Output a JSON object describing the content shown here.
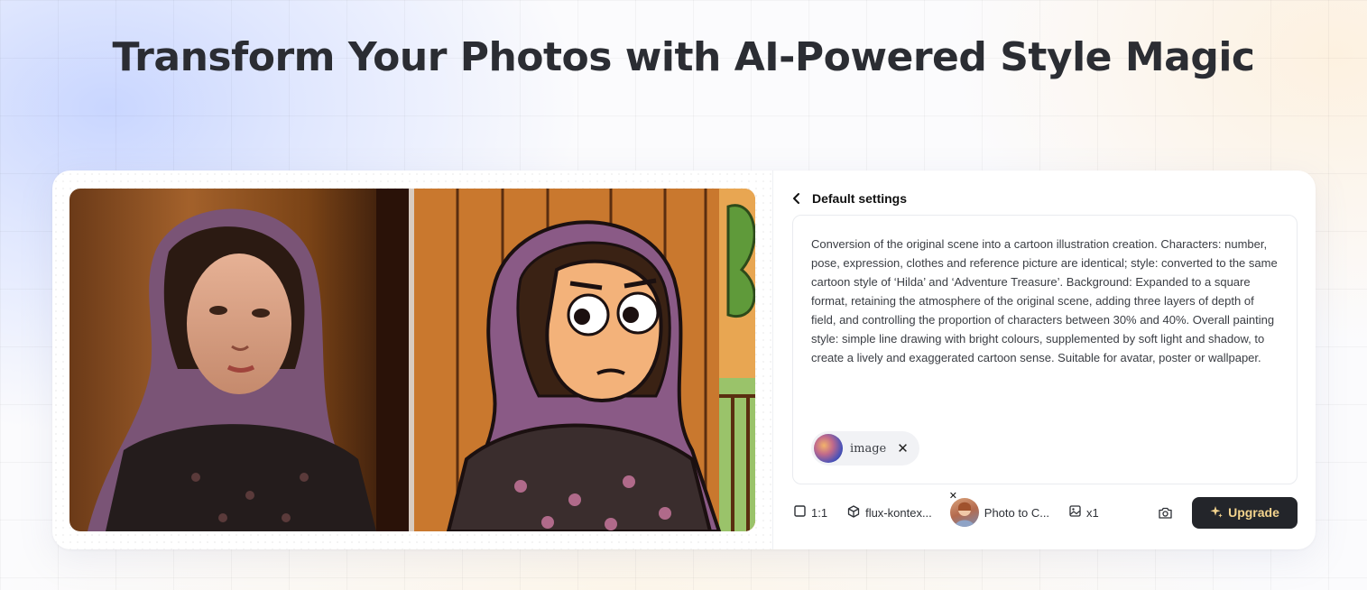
{
  "hero": {
    "title": "Transform Your Photos with AI-Powered Style Magic"
  },
  "settings": {
    "title": "Default settings",
    "prompt": "Conversion of the original scene into a cartoon illustration creation. Characters: number, pose, expression, clothes and reference picture are identical; style: converted to the same cartoon style of ‘Hilda’ and ‘Adventure Treasure’. Background: Expanded to a square format, retaining the atmosphere of the original scene, adding three layers of depth of field, and controlling the proportion of characters between 30% and 40%. Overall painting style: simple line drawing with bright colours, supplemented by soft light and shadow, to create a lively and exaggerated cartoon sense. Suitable for avatar, poster or wallpaper.",
    "attachment": {
      "label": "image",
      "close": "✕"
    }
  },
  "toolbar": {
    "ratio": "1:1",
    "model": "flux-kontex...",
    "style": "Photo to C...",
    "style_close": "✕",
    "count": "x1",
    "upgrade": "Upgrade"
  },
  "icons": {
    "back": "chevron-left-icon",
    "ratio": "square-icon",
    "model": "cube-icon",
    "count": "image-icon",
    "camera": "camera-icon",
    "upgrade": "sparkle-icon"
  },
  "colors": {
    "upgrade_bg": "#23252a",
    "upgrade_text": "#f3d38d",
    "scarf": "#8a5a86"
  }
}
